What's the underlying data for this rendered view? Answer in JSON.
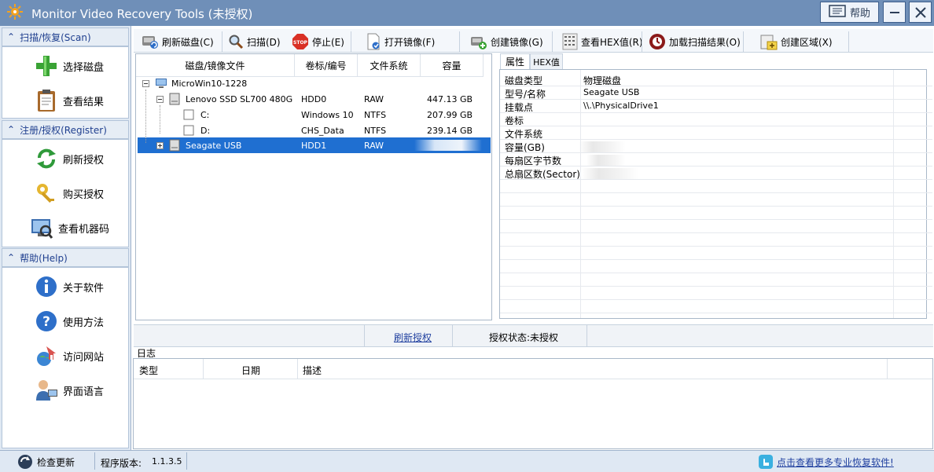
{
  "window": {
    "title": "Monitor Video Recovery Tools (未授权)",
    "help_label": "帮助"
  },
  "sidebar": {
    "sections": [
      {
        "title": "扫描/恢复(Scan)",
        "items": [
          {
            "label": "选择磁盘",
            "icon": "plus-icon"
          },
          {
            "label": "查看结果",
            "icon": "clipboard-icon"
          }
        ]
      },
      {
        "title": "注册/授权(Register)",
        "items": [
          {
            "label": "刷新授权",
            "icon": "refresh-icon"
          },
          {
            "label": "购买授权",
            "icon": "key-icon"
          },
          {
            "label": "查看机器码",
            "icon": "machine-code-icon"
          }
        ]
      },
      {
        "title": "帮助(Help)",
        "items": [
          {
            "label": "关于软件",
            "icon": "info-icon"
          },
          {
            "label": "使用方法",
            "icon": "question-icon"
          },
          {
            "label": "访问网站",
            "icon": "home-globe-icon"
          },
          {
            "label": "界面语言",
            "icon": "user-language-icon"
          }
        ]
      }
    ]
  },
  "toolbar": {
    "refresh_disk": "刷新磁盘(C)",
    "scan": "扫描(D)",
    "stop": "停止(E)",
    "open_image": "打开镜像(F)",
    "create_image": "创建镜像(G)",
    "view_hex": "查看HEX值(R)",
    "load_results": "加载扫描结果(O)",
    "create_region": "创建区域(X)"
  },
  "disk_table": {
    "headers": [
      "磁盘/镜像文件",
      "卷标/编号",
      "文件系统",
      "容量"
    ],
    "rows": [
      {
        "name": "MicroWin10-1228",
        "label": "",
        "fs": "",
        "size": ""
      },
      {
        "name": "Lenovo SSD SL700 480G",
        "label": "HDD0",
        "fs": "RAW",
        "size": "447.13 GB"
      },
      {
        "name": "C:",
        "label": "Windows 10",
        "fs": "NTFS",
        "size": "207.99 GB"
      },
      {
        "name": "D:",
        "label": "CHS_Data",
        "fs": "NTFS",
        "size": "239.14 GB"
      },
      {
        "name": "Seagate USB",
        "label": "HDD1",
        "fs": "RAW",
        "size": ""
      }
    ]
  },
  "properties": {
    "tabs": [
      "属性",
      "HEX值"
    ],
    "rows": [
      {
        "key": "磁盘类型",
        "value": "物理磁盘"
      },
      {
        "key": "型号/名称",
        "value": "Seagate USB"
      },
      {
        "key": "挂载点",
        "value": "\\\\.\\PhysicalDrive1"
      },
      {
        "key": "卷标",
        "value": ""
      },
      {
        "key": "文件系统",
        "value": ""
      },
      {
        "key": "容量(GB)",
        "value": ""
      },
      {
        "key": "每扇区字节数",
        "value": ""
      },
      {
        "key": "总扇区数(Sector)",
        "value": ""
      }
    ]
  },
  "license_strip": {
    "refresh_link": "刷新授权",
    "status": "授权状态:未授权"
  },
  "log": {
    "title": "日志",
    "headers": [
      "类型",
      "日期",
      "描述"
    ]
  },
  "statusbar": {
    "check_update": "检查更新",
    "version_label": "程序版本:",
    "version": "1.1.3.5",
    "promo_link": "点击查看更多专业恢复软件!"
  }
}
